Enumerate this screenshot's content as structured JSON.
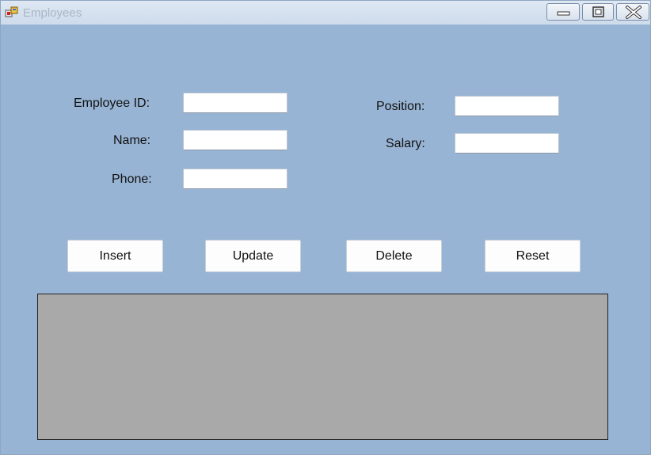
{
  "window": {
    "title": "Employees",
    "controls": {
      "minimize_icon": "minimize-icon",
      "maximize_icon": "maximize-icon",
      "close_icon": "close-icon"
    }
  },
  "form": {
    "employee_id": {
      "label": "Employee ID:",
      "value": ""
    },
    "name": {
      "label": "Name:",
      "value": ""
    },
    "phone": {
      "label": "Phone:",
      "value": ""
    },
    "position": {
      "label": "Position:",
      "value": ""
    },
    "salary": {
      "label": "Salary:",
      "value": ""
    }
  },
  "buttons": {
    "insert": "Insert",
    "update": "Update",
    "delete": "Delete",
    "reset": "Reset"
  },
  "colors": {
    "form_background": "#98b4d4",
    "grid_background": "#a9a9a9"
  }
}
